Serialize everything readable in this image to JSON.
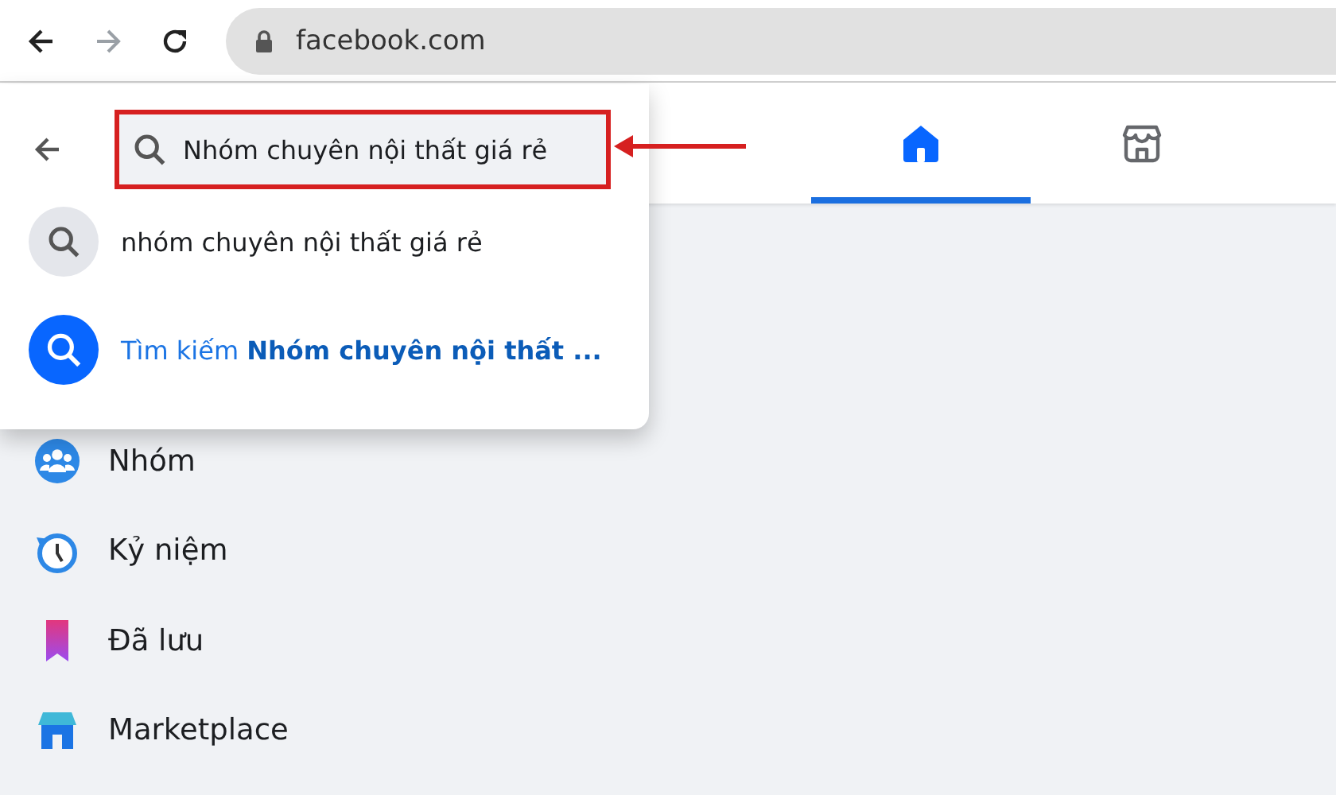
{
  "browser": {
    "url": "facebook.com"
  },
  "header_tabs": [
    {
      "kind": "home",
      "selected": true
    },
    {
      "kind": "marketplace",
      "selected": false
    }
  ],
  "search_dropdown": {
    "value": "Nhóm chuyên nội thất giá rẻ",
    "highlighted": true,
    "suggestions": [
      {
        "kind": "recent",
        "text": "nhóm chuyên nội thất giá rẻ"
      },
      {
        "kind": "search_all",
        "text": "Tìm kiếm **Nhóm chuyên nội thất ...**"
      }
    ]
  },
  "sidebar": {
    "items": [
      {
        "kind": "groups",
        "label": "Nhóm"
      },
      {
        "kind": "memories",
        "label": "Kỷ niệm"
      },
      {
        "kind": "saved",
        "label": "Đã lưu"
      },
      {
        "kind": "marketplace",
        "label": "Marketplace"
      }
    ]
  }
}
